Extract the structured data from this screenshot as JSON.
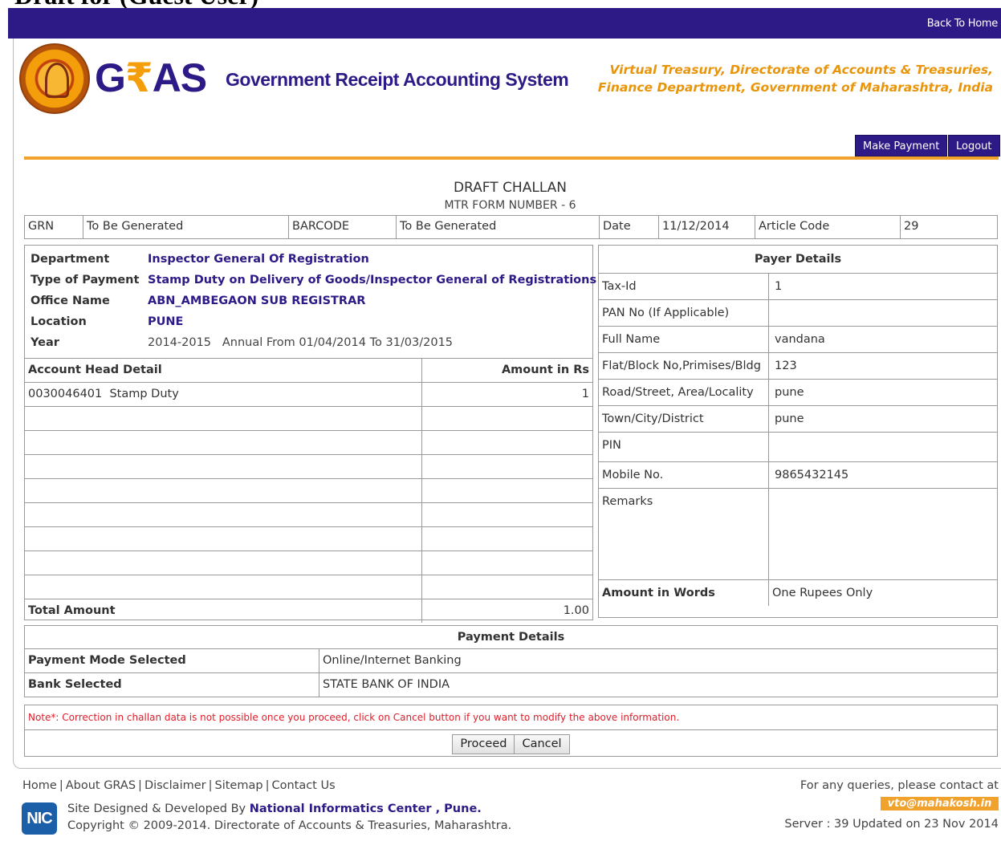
{
  "doc_heading": "Draft for (Guest User)",
  "topbar": {
    "back_home": "Back To Home"
  },
  "header": {
    "logo_g": "G",
    "logo_rupee": "₹",
    "logo_as": "AS",
    "logo_tagline": "Government Receipt Accounting System",
    "right_line1": "Virtual Treasury, Directorate of Accounts & Treasuries,",
    "right_line2": "Finance Department, Government of Maharashtra, India"
  },
  "actions": {
    "make_payment": "Make Payment",
    "logout": "Logout"
  },
  "challan": {
    "title": "DRAFT CHALLAN",
    "subtitle": "MTR FORM NUMBER - 6"
  },
  "grn_row": {
    "grn_label": "GRN",
    "grn_value": "To Be Generated",
    "barcode_label": "BARCODE",
    "barcode_value": "To Be Generated",
    "date_label": "Date",
    "date_value": "11/12/2014",
    "article_label": "Article Code",
    "article_value": "29"
  },
  "details": {
    "department_label": "Department",
    "department_value": "Inspector General Of Registration",
    "type_label": "Type of Payment",
    "type_value": "Stamp Duty on Delivery of Goods/Inspector General of Registrations",
    "office_label": "Office Name",
    "office_value": "ABN_AMBEGAON SUB REGISTRAR",
    "location_label": "Location",
    "location_value": "PUNE",
    "year_label": "Year",
    "year_value": "2014-2015   Annual From 01/04/2014 To 31/03/2015"
  },
  "account": {
    "head_label": "Account Head Detail",
    "amount_label": "Amount in Rs",
    "rows": [
      {
        "head": "0030046401  Stamp Duty",
        "amount": "1"
      },
      {
        "head": "",
        "amount": ""
      },
      {
        "head": "",
        "amount": ""
      },
      {
        "head": "",
        "amount": ""
      },
      {
        "head": "",
        "amount": ""
      },
      {
        "head": "",
        "amount": ""
      },
      {
        "head": "",
        "amount": ""
      },
      {
        "head": "",
        "amount": ""
      },
      {
        "head": "",
        "amount": ""
      }
    ],
    "total_label": "Total Amount",
    "total_value": "1.00"
  },
  "payer": {
    "title": "Payer Details",
    "rows": [
      {
        "label": "Tax-Id",
        "value": "1"
      },
      {
        "label": "PAN No (If Applicable)",
        "value": ""
      },
      {
        "label": "Full Name",
        "value": "vandana"
      },
      {
        "label": "Flat/Block No,Primises/Bldg",
        "value": "123"
      },
      {
        "label": "Road/Street, Area/Locality",
        "value": "pune"
      },
      {
        "label": "Town/City/District",
        "value": "pune"
      },
      {
        "label": "PIN",
        "value": ""
      },
      {
        "label": "Mobile No.",
        "value": "9865432145"
      },
      {
        "label": "Remarks",
        "value": ""
      }
    ],
    "words_label": "Amount in Words",
    "words_value": "One Rupees Only"
  },
  "payment": {
    "title": "Payment Details",
    "mode_label": "Payment Mode Selected",
    "mode_value": "Online/Internet Banking",
    "bank_label": "Bank Selected",
    "bank_value": "STATE BANK OF INDIA"
  },
  "note": "Note*: Correction in challan data is not possible once you proceed, click on Cancel button if you want to modify the above information.",
  "buttons": {
    "proceed": "Proceed",
    "cancel": "Cancel"
  },
  "footer": {
    "links": [
      "Home",
      "About GRAS",
      "Disclaimer",
      "Sitemap",
      "Contact Us"
    ],
    "nic_logo": "NIC",
    "designed_prefix": "Site Designed & Developed By ",
    "designed_org": "National Informatics Center , Pune.",
    "copyright": "Copyright © 2009-2014. Directorate of Accounts & Treasuries, Maharashtra.",
    "query_text": "For any queries, please contact at",
    "email": "vto@mahakosh.in",
    "server": "Server : 39 Updated on 23 Nov 2014"
  },
  "colors": {
    "brand_purple": "#2e1a87",
    "accent_orange": "#f0a22c",
    "note_red": "#e11d2a"
  }
}
